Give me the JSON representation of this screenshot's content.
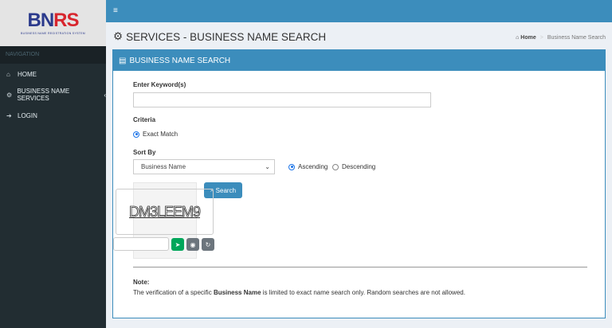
{
  "logo": {
    "text_a": "BN",
    "text_b": "RS",
    "subtitle": "BUSINESS NAME REGISTRATION SYSTEM"
  },
  "sidebar": {
    "header": "NAVIGATION",
    "items": [
      {
        "label": "HOME",
        "icon": "home-icon"
      },
      {
        "label": "BUSINESS NAME SERVICES",
        "icon": "cogs-icon",
        "chevron": "‹"
      },
      {
        "label": "LOGIN",
        "icon": "sign-in-icon"
      }
    ]
  },
  "page": {
    "title": "SERVICES - BUSINESS NAME SEARCH",
    "breadcrumb": {
      "home": "Home",
      "sep": ">",
      "current": "Business Name Search"
    }
  },
  "box": {
    "title": "BUSINESS NAME SEARCH"
  },
  "form": {
    "keyword_label": "Enter Keyword(s)",
    "keyword_value": "",
    "criteria_label": "Criteria",
    "criteria_option": "Exact Match",
    "sortby_label": "Sort By",
    "sortby_value": "Business Name",
    "asc_label": "Ascending",
    "desc_label": "Descending",
    "order_selected": "Ascending",
    "search_label": "Search"
  },
  "captcha": {
    "text": "DM3LEEM9",
    "input_value": ""
  },
  "note": {
    "title": "Note:",
    "pre": "The verification of a specific ",
    "bold": "Business Name",
    "post": " is limited to exact name search only. Random searches are not allowed."
  },
  "colors": {
    "primary": "#3c8dbc",
    "sidebar": "#222d32",
    "success": "#00a65a"
  }
}
